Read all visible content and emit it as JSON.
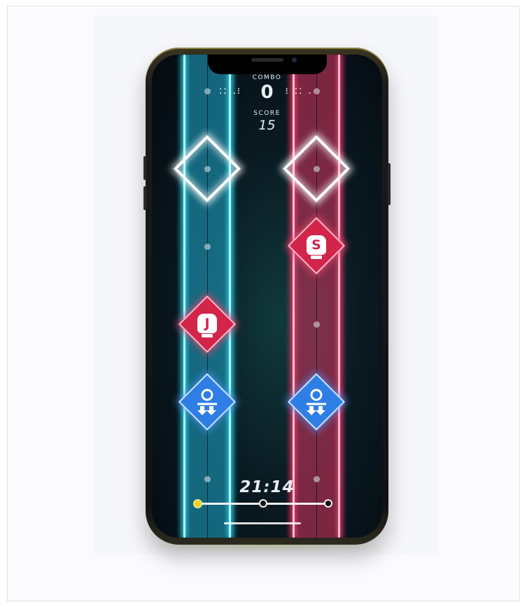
{
  "game": {
    "combo_label": "COMBO",
    "combo_value": "0",
    "score_label": "SCORE",
    "score_value": "15",
    "time_value": "21:14",
    "progress_fraction": 0.0
  },
  "lanes": [
    {
      "name": "left",
      "color": "#29d4ef"
    },
    {
      "name": "right",
      "color": "#ef3a6c"
    }
  ],
  "notes": [
    {
      "lane": "right",
      "type": "punch",
      "letter": "S"
    },
    {
      "lane": "left",
      "type": "punch",
      "letter": "J"
    },
    {
      "lane": "left",
      "type": "duck"
    },
    {
      "lane": "right",
      "type": "duck"
    }
  ],
  "colors": {
    "blue_lane": "#29d4ef",
    "red_lane": "#ef3a6c",
    "punch_note": "#d3244a",
    "duck_note": "#2f7ee6",
    "progress_marker": "#f2d52c"
  }
}
